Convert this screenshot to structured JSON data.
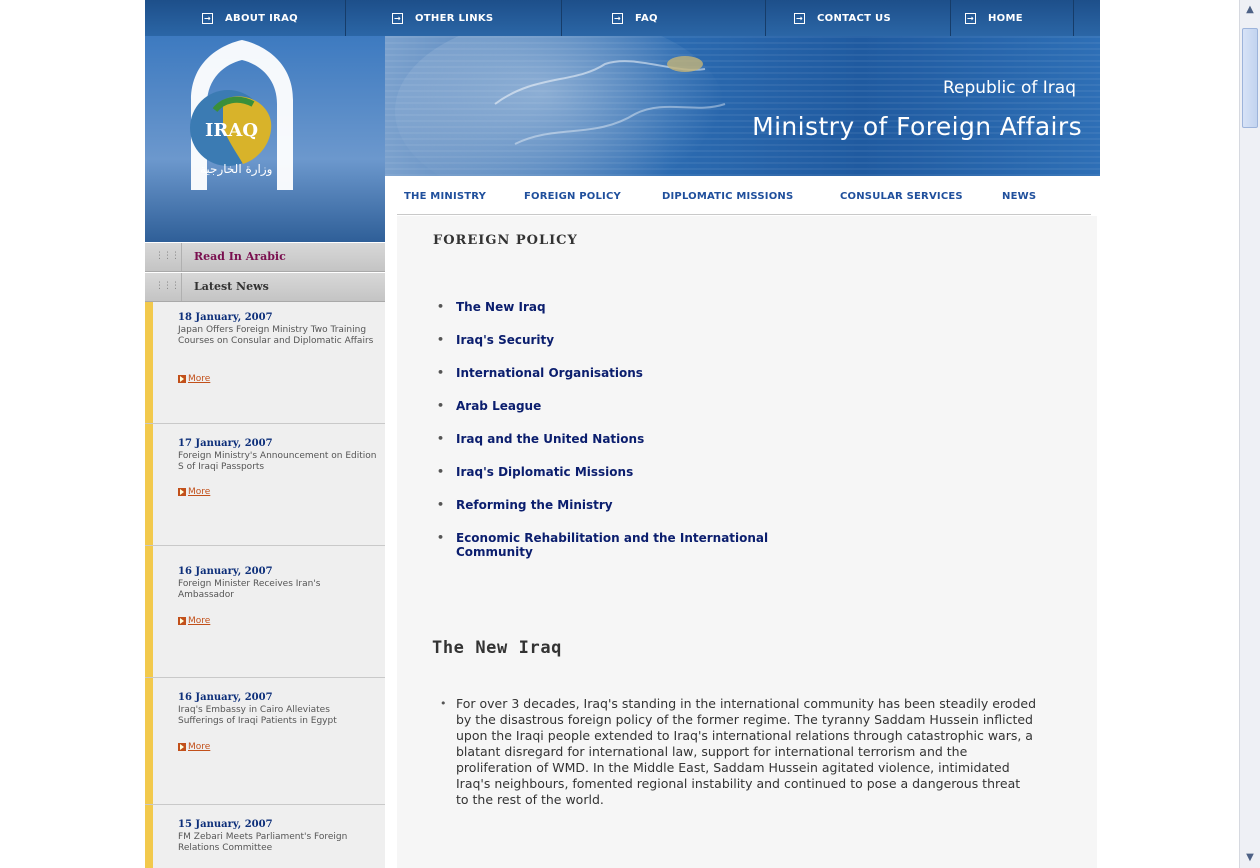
{
  "topnav": {
    "items": [
      {
        "label": "ABOUT IRAQ"
      },
      {
        "label": "OTHER LINKS"
      },
      {
        "label": "FAQ"
      },
      {
        "label": "CONTACT US"
      },
      {
        "label": "HOME"
      }
    ]
  },
  "banner": {
    "subtitle": "Republic of Iraq",
    "title": "Ministry of Foreign Affairs"
  },
  "logo": {
    "text": "IRAQ",
    "arabic": "وزارة الخارجية"
  },
  "menu": {
    "items": [
      {
        "label": "THE MINISTRY"
      },
      {
        "label": "FOREIGN POLICY"
      },
      {
        "label": "DIPLOMATIC MISSIONS"
      },
      {
        "label": "CONSULAR SERVICES"
      },
      {
        "label": "NEWS"
      }
    ]
  },
  "sidebar": {
    "read_arabic": "Read In Arabic",
    "latest_news": "Latest News",
    "more_label": "More",
    "news": [
      {
        "date": "18 January, 2007",
        "text": "Japan Offers Foreign Ministry Two Training Courses on Consular and Diplomatic Affairs"
      },
      {
        "date": "17 January, 2007",
        "text": "Foreign Ministry's Announcement on Edition S of Iraqi Passports"
      },
      {
        "date": "16 January, 2007",
        "text": "Foreign Minister Receives Iran's Ambassador"
      },
      {
        "date": "16 January, 2007",
        "text": "Iraq's Embassy in Cairo Alleviates Sufferings of Iraqi Patients in Egypt"
      },
      {
        "date": "15 January, 2007",
        "text": "FM Zebari Meets Parliament's Foreign Relations Committee"
      }
    ]
  },
  "content": {
    "section_title": "FOREIGN POLICY",
    "links": [
      "The New Iraq",
      "Iraq's Security",
      "International Organisations",
      "Arab League",
      "Iraq and the United Nations",
      "Iraq's Diplomatic Missions",
      "Reforming the Ministry",
      "Economic Rehabilitation and the International Community"
    ],
    "heading": "The New Iraq",
    "paragraph": "For over 3 decades, Iraq's standing in the international community has been steadily eroded by the disastrous foreign policy of the former regime. The tyranny Saddam Hussein inflicted upon the Iraqi people extended to Iraq's international relations through catastrophic wars, a blatant disregard for international law, support for international terrorism and the proliferation of WMD. In the Middle East, Saddam Hussein agitated violence, intimidated Iraq's neighbours, fomented regional instability and continued to pose a dangerous threat to the rest of the world."
  },
  "colors": {
    "nav_blue": "#1d4f8a",
    "link_navy": "#0b1e6e",
    "menu_blue": "#1f4f9c",
    "news_accent": "#f2c94c",
    "arabic_label": "#7a0f4f"
  }
}
